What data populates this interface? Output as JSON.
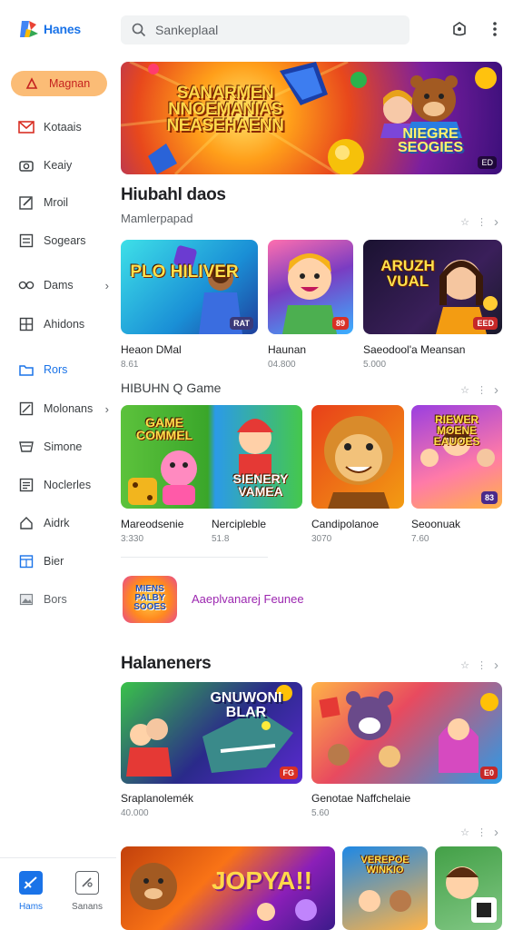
{
  "app": {
    "name": "Hanes"
  },
  "search": {
    "placeholder": "Sankeplaal"
  },
  "sidebar": {
    "items": [
      {
        "label": "Magnan",
        "icon": "flame-icon",
        "active": true
      },
      {
        "label": "Kotaais",
        "icon": "mail-icon"
      },
      {
        "label": "Keaiy",
        "icon": "camera-icon"
      },
      {
        "label": "Mroil",
        "icon": "edit-icon"
      },
      {
        "label": "Sogears",
        "icon": "document-icon"
      },
      {
        "label": "Dams",
        "icon": "infinity-icon",
        "chevron": true
      },
      {
        "label": "Ahidons",
        "icon": "grid-icon"
      },
      {
        "label": "Rors",
        "icon": "folder-icon"
      },
      {
        "label": "Molonans",
        "icon": "square-slash-icon",
        "chevron": true
      },
      {
        "label": "Simone",
        "icon": "inbox-icon"
      },
      {
        "label": "Noclerles",
        "icon": "list-icon"
      },
      {
        "label": "Aidrk",
        "icon": "home-icon"
      },
      {
        "label": "Bier",
        "icon": "calendar-icon"
      },
      {
        "label": "Bors",
        "icon": "image-icon"
      }
    ]
  },
  "hero": {
    "title": "SANARMEN NNOEMANIAS NEASEHAENN",
    "subtitle": "NIEGRE SEOGIES",
    "badge": "ED"
  },
  "sections": [
    {
      "title": "Hiubahl daos",
      "subtitle": "Mamlerpapad",
      "cards": [
        {
          "name": "Heaon DMal",
          "meta": "8.61",
          "badge": "RAT",
          "word": "PLO HILIVER"
        },
        {
          "name": "Haunan",
          "meta": "04.800",
          "badge": "89",
          "word": ""
        },
        {
          "name": "Saeodool'a Meansan",
          "meta": "5.000",
          "badge": "EED",
          "word": "ARUZH VUAL"
        }
      ]
    },
    {
      "title": "HIBUHN Q Game",
      "cards": [
        {
          "name": "Mareodsenie",
          "meta": "3:330",
          "badge": "",
          "word": "GAME COMMEL"
        },
        {
          "name": "Nercipleble",
          "meta": "51.8",
          "badge": "",
          "word": "SIENERY VAMEA"
        },
        {
          "name": "Candipolanoe",
          "meta": "3070",
          "badge": "",
          "word": ""
        },
        {
          "name": "Seoonuak",
          "meta": "7.60",
          "badge": "83",
          "word": "RIEWER MOENE EAUOES"
        }
      ]
    }
  ],
  "promo": {
    "logo_text": "MIENS PALBY SOOES",
    "text": "Aaeplvanarej Feunee"
  },
  "section3": {
    "title": "Halaneners",
    "cards": [
      {
        "name": "Sraplanolemék",
        "meta": "40.000",
        "badge": "FG",
        "word": "GNUWONI BLAR"
      },
      {
        "name": "Genotae Naffchelaie",
        "meta": "5.60",
        "badge": "E0",
        "word": ""
      }
    ]
  },
  "bottom_nav": [
    {
      "label": "Hams",
      "icon": "game-controller-icon",
      "active": true
    },
    {
      "label": "Sanans",
      "icon": "stats-icon"
    }
  ],
  "bottom_row": {
    "word": "JOPYA!!",
    "word2": "VEREPOE WINKIO"
  },
  "colors": {
    "accent": "#1a73e8",
    "active_bg": "#fbbc76",
    "active_text": "#c5221f",
    "badge": "#d93025"
  }
}
